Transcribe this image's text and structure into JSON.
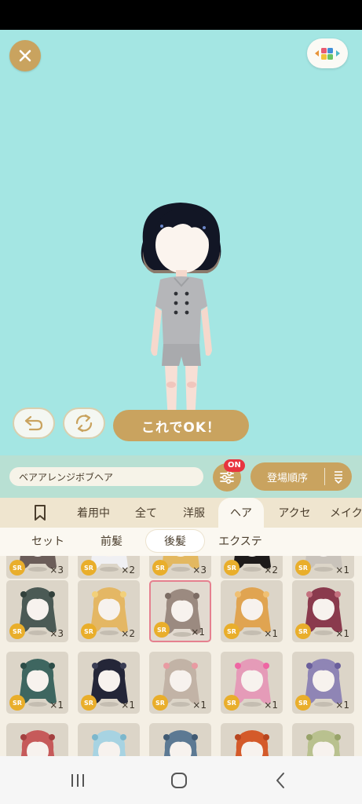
{
  "item_name": "ベアアレンジボブヘア",
  "ok_label": "これでOK！",
  "filter_badge": "ON",
  "sort_label": "登場順序",
  "category_tabs": [
    {
      "label": "着用中"
    },
    {
      "label": "全て"
    },
    {
      "label": "洋服"
    },
    {
      "label": "ヘア",
      "active": true
    },
    {
      "label": "アクセ"
    },
    {
      "label": "メイク"
    }
  ],
  "sub_tabs": [
    {
      "label": "セット"
    },
    {
      "label": "前髪"
    },
    {
      "label": "後髪",
      "active": true
    },
    {
      "label": "エクステ"
    }
  ],
  "rarity_label": "SR",
  "items": [
    {
      "count": "×3",
      "hair": "#6b5d59",
      "accent": "#6b5d59"
    },
    {
      "count": "×2",
      "hair": "#f0f0f3",
      "accent": "#c8ccd8"
    },
    {
      "count": "×3",
      "hair": "#e3b860",
      "accent": "#b98a3e"
    },
    {
      "count": "×2",
      "hair": "#1d1a1a",
      "accent": "#3a3535"
    },
    {
      "count": "×1",
      "hair": "#c9c3bb",
      "accent": "#b5aea5"
    },
    {
      "count": "×3",
      "hair": "#4b5a55",
      "accent": "#32413c"
    },
    {
      "count": "×2",
      "hair": "#e4b764",
      "accent": "#f2d07a"
    },
    {
      "count": "×1",
      "hair": "#9b8a80",
      "accent": "#7c6c64",
      "selected": true
    },
    {
      "count": "×1",
      "hair": "#e0a451",
      "accent": "#f0c073"
    },
    {
      "count": "×1",
      "hair": "#8a3a4d",
      "accent": "#c4717f"
    },
    {
      "count": "×1",
      "hair": "#3e6660",
      "accent": "#2c4d48"
    },
    {
      "count": "×1",
      "hair": "#242638",
      "accent": "#3a3d54"
    },
    {
      "count": "×1",
      "hair": "#c2b3a6",
      "accent": "#e89ba2"
    },
    {
      "count": "×1",
      "hair": "#e59bb8",
      "accent": "#ee66a3"
    },
    {
      "count": "×1",
      "hair": "#8f85b5",
      "accent": "#6a5f9c"
    },
    {
      "count": "",
      "hair": "#c65a5a",
      "accent": "#a44040"
    },
    {
      "count": "",
      "hair": "#a7d3e2",
      "accent": "#7cb7cc"
    },
    {
      "count": "",
      "hair": "#5c7993",
      "accent": "#405a73"
    },
    {
      "count": "",
      "hair": "#d45a2a",
      "accent": "#b84620"
    },
    {
      "count": "",
      "hair": "#b9c18f",
      "accent": "#98a36a"
    }
  ],
  "icons": {
    "close": "close-icon",
    "palette": "color-palette-icon",
    "undo": "undo-icon",
    "rotate": "rotate-icon",
    "filter": "filter-sliders-icon",
    "sort": "sort-order-icon",
    "bookmark": "bookmark-icon",
    "recents": "recent-apps-icon",
    "home": "home-icon",
    "back": "back-icon"
  },
  "colors": {
    "stage_bg": "#a4e6e3",
    "gold": "#c9a35f",
    "badge_red": "#e8343f",
    "rarity_gold": "#e9ae2b"
  }
}
